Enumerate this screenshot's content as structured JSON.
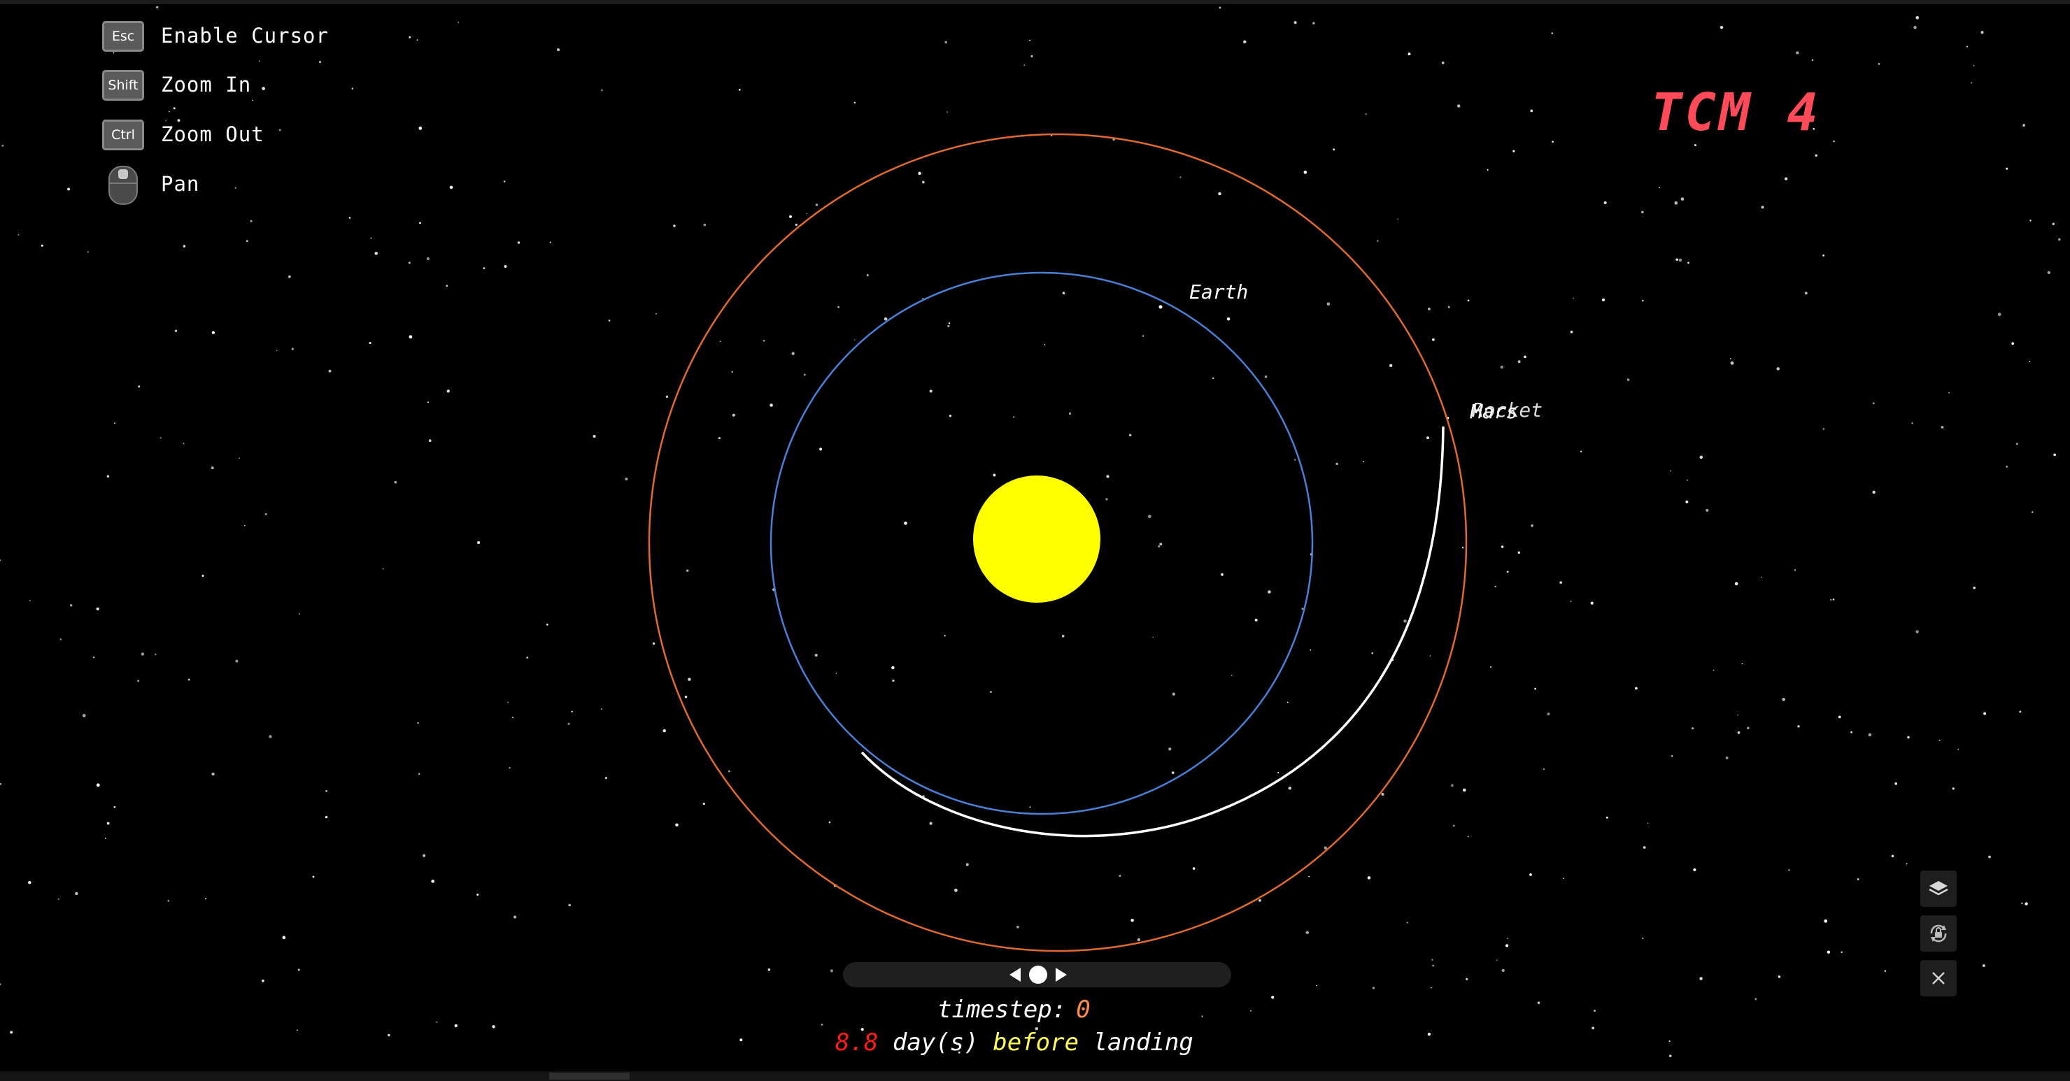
{
  "controls": [
    {
      "key": "Esc",
      "label": "Enable Cursor",
      "icon": "keycap"
    },
    {
      "key": "Shift",
      "label": "Zoom In",
      "icon": "keycap"
    },
    {
      "key": "Ctrl",
      "label": "Zoom Out",
      "icon": "keycap"
    },
    {
      "key": "",
      "label": "Pan",
      "icon": "mouse-icon"
    }
  ],
  "title": "TCM 4",
  "bodies": {
    "sun_color": "#ffff00",
    "earth": {
      "label": "Earth",
      "orbit_color": "#4a7fd6"
    },
    "mars": {
      "label": "Mars",
      "orbit_color": "#e06a2e"
    },
    "rocket": {
      "label": "Rocket",
      "trajectory_color": "#ffffff"
    }
  },
  "toolbar": {
    "icons": [
      "layers-icon",
      "camera-lock-icon",
      "close-icon"
    ]
  },
  "timeline": {
    "timestep_label": "timestep:",
    "timestep_value": "0",
    "days_value": "8.8",
    "days_text": "day(s)",
    "before_text": "before",
    "landing_text": "landing"
  },
  "colors": {
    "background": "#000000",
    "title_red": "#ff4a5a",
    "timestep_value": "#ff8a4a",
    "days_red": "#ff1a1a",
    "before_yellow": "#ffff55"
  }
}
